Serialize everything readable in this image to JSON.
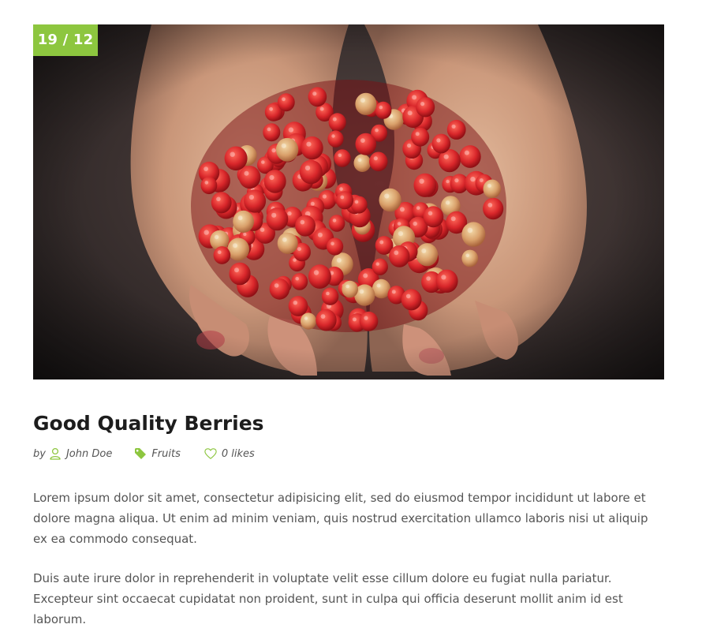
{
  "post": {
    "date_badge": "19 / 12",
    "title": "Good Quality Berries",
    "meta": {
      "by_label": "by",
      "author": "John Doe",
      "category": "Fruits",
      "likes": "0 likes"
    },
    "paragraphs": [
      "Lorem ipsum dolor sit amet, consectetur adipisicing elit, sed do eiusmod tempor incididunt ut labore et dolore magna aliqua. Ut enim ad minim veniam, quis nostrud exercitation ullamco laboris nisi ut aliquip ex ea commodo consequat.",
      "Duis aute irure dolor in reprehenderit in voluptate velit esse cillum dolore eu fugiat nulla pariatur. Excepteur sint occaecat cupidatat non proident, sunt in culpa qui officia deserunt mollit anim id est laborum."
    ]
  },
  "icons": {
    "author": "user-icon",
    "category": "tag-icon",
    "likes": "heart-icon"
  },
  "colors": {
    "accent": "#8dc63f",
    "title": "#1d1d1d",
    "body_text": "#555555"
  }
}
